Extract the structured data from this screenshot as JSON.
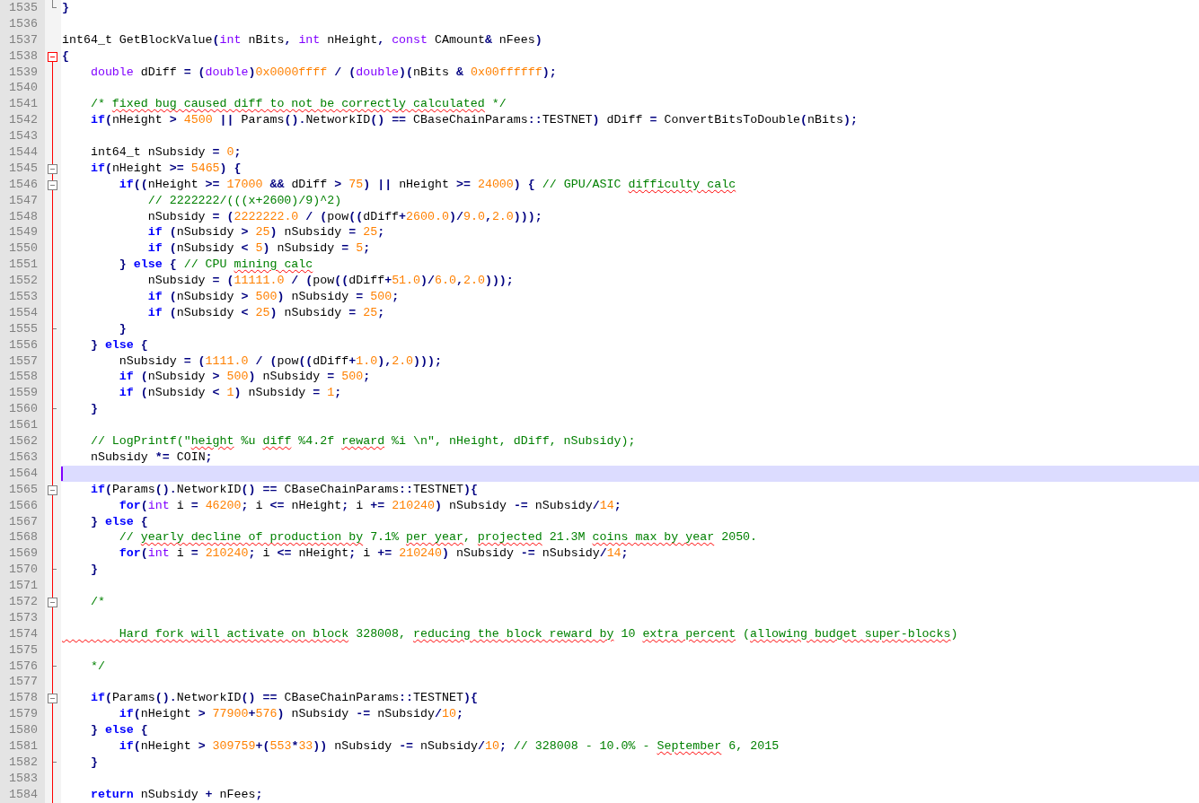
{
  "editor": {
    "lines": [
      {
        "number": "1535",
        "fold_open": false,
        "fold_end": true,
        "in_block": false,
        "current": false,
        "tokens": [
          {
            "kind": "op",
            "text": "}"
          }
        ]
      },
      {
        "number": "1536",
        "fold_open": false,
        "fold_end": false,
        "in_block": false,
        "current": false
      },
      {
        "number": "1537",
        "fold_open": false,
        "fold_end": false,
        "in_block": false,
        "current": false,
        "tokens": [
          {
            "kind": "plain",
            "text": "int64_t GetBlockValue"
          },
          {
            "kind": "op",
            "text": "("
          },
          {
            "kind": "type",
            "text": "int"
          },
          {
            "kind": "plain",
            "text": " nBits"
          },
          {
            "kind": "op",
            "text": ", "
          },
          {
            "kind": "type",
            "text": "int"
          },
          {
            "kind": "plain",
            "text": " nHeight"
          },
          {
            "kind": "op",
            "text": ", "
          },
          {
            "kind": "type",
            "text": "const"
          },
          {
            "kind": "plain",
            "text": " CAmount"
          },
          {
            "kind": "op",
            "text": "&"
          },
          {
            "kind": "plain",
            "text": " nFees"
          },
          {
            "kind": "op",
            "text": ")"
          }
        ]
      },
      {
        "number": "1538",
        "fold_open": true,
        "fold_end": false,
        "in_block": true,
        "current": false,
        "tokens": [
          {
            "kind": "op",
            "text": "{"
          }
        ]
      },
      {
        "number": "1539",
        "fold_open": false,
        "fold_end": false,
        "in_block": true,
        "current": false,
        "tokens": [
          {
            "kind": "type",
            "text": "    double"
          },
          {
            "kind": "plain",
            "text": " dDiff "
          },
          {
            "kind": "op",
            "text": "= ("
          },
          {
            "kind": "type",
            "text": "double"
          },
          {
            "kind": "op",
            "text": ")"
          },
          {
            "kind": "number",
            "text": "0x0000ffff"
          },
          {
            "kind": "op",
            "text": " / ("
          },
          {
            "kind": "type",
            "text": "double"
          },
          {
            "kind": "op",
            "text": ")("
          },
          {
            "kind": "plain",
            "text": "nBits "
          },
          {
            "kind": "op",
            "text": "& "
          },
          {
            "kind": "number",
            "text": "0x00ffffff"
          },
          {
            "kind": "op",
            "text": ");"
          }
        ]
      },
      {
        "number": "1540",
        "fold_open": false,
        "fold_end": false,
        "in_block": true,
        "current": false
      },
      {
        "number": "1541",
        "fold_open": false,
        "fold_end": false,
        "in_block": true,
        "current": false,
        "tokens": [
          {
            "kind": "comment",
            "text": "    /* "
          },
          {
            "kind": "typo",
            "text": "fixed bug caused diff to not be correctly calculated"
          },
          {
            "kind": "comment",
            "text": " */"
          }
        ]
      },
      {
        "number": "1542",
        "fold_open": false,
        "fold_end": false,
        "in_block": true,
        "current": false,
        "tokens": [
          {
            "kind": "keyword",
            "text": "    if"
          },
          {
            "kind": "op",
            "text": "("
          },
          {
            "kind": "plain",
            "text": "nHeight "
          },
          {
            "kind": "op",
            "text": "> "
          },
          {
            "kind": "number",
            "text": "4500"
          },
          {
            "kind": "op",
            "text": " || "
          },
          {
            "kind": "plain",
            "text": "Params"
          },
          {
            "kind": "op",
            "text": "()."
          },
          {
            "kind": "plain",
            "text": "NetworkID"
          },
          {
            "kind": "op",
            "text": "() == "
          },
          {
            "kind": "plain",
            "text": "CBaseChainParams"
          },
          {
            "kind": "op",
            "text": "::"
          },
          {
            "kind": "plain",
            "text": "TESTNET"
          },
          {
            "kind": "op",
            "text": ") "
          },
          {
            "kind": "plain",
            "text": "dDiff "
          },
          {
            "kind": "op",
            "text": "= "
          },
          {
            "kind": "plain",
            "text": "ConvertBitsToDouble"
          },
          {
            "kind": "op",
            "text": "("
          },
          {
            "kind": "plain",
            "text": "nBits"
          },
          {
            "kind": "op",
            "text": ");"
          }
        ]
      },
      {
        "number": "1543",
        "fold_open": false,
        "fold_end": false,
        "in_block": true,
        "current": false
      },
      {
        "number": "1544",
        "fold_open": false,
        "fold_end": false,
        "in_block": true,
        "current": false,
        "tokens": [
          {
            "kind": "plain",
            "text": "    int64_t nSubsidy "
          },
          {
            "kind": "op",
            "text": "= "
          },
          {
            "kind": "number",
            "text": "0"
          },
          {
            "kind": "op",
            "text": ";"
          }
        ]
      },
      {
        "number": "1545",
        "fold_open": true,
        "fold_end": false,
        "in_block": true,
        "current": false,
        "tokens": [
          {
            "kind": "keyword",
            "text": "    if"
          },
          {
            "kind": "op",
            "text": "("
          },
          {
            "kind": "plain",
            "text": "nHeight "
          },
          {
            "kind": "op",
            "text": ">= "
          },
          {
            "kind": "number",
            "text": "5465"
          },
          {
            "kind": "op",
            "text": ") {"
          }
        ]
      },
      {
        "number": "1546",
        "fold_open": true,
        "fold_end": false,
        "in_block": true,
        "current": false,
        "tokens": [
          {
            "kind": "keyword",
            "text": "        if"
          },
          {
            "kind": "op",
            "text": "(("
          },
          {
            "kind": "plain",
            "text": "nHeight "
          },
          {
            "kind": "op",
            "text": ">= "
          },
          {
            "kind": "number",
            "text": "17000"
          },
          {
            "kind": "op",
            "text": " && "
          },
          {
            "kind": "plain",
            "text": "dDiff "
          },
          {
            "kind": "op",
            "text": "> "
          },
          {
            "kind": "number",
            "text": "75"
          },
          {
            "kind": "op",
            "text": ") || "
          },
          {
            "kind": "plain",
            "text": "nHeight "
          },
          {
            "kind": "op",
            "text": ">= "
          },
          {
            "kind": "number",
            "text": "24000"
          },
          {
            "kind": "op",
            "text": ") { "
          },
          {
            "kind": "comment",
            "text": "// GPU/ASIC "
          },
          {
            "kind": "typo",
            "text": "difficulty calc"
          }
        ]
      },
      {
        "number": "1547",
        "fold_open": false,
        "fold_end": false,
        "in_block": true,
        "current": false,
        "tokens": [
          {
            "kind": "comment",
            "text": "            // 2222222/(((x+2600)/9)^2)"
          }
        ]
      },
      {
        "number": "1548",
        "fold_open": false,
        "fold_end": false,
        "in_block": true,
        "current": false,
        "tokens": [
          {
            "kind": "plain",
            "text": "            nSubsidy "
          },
          {
            "kind": "op",
            "text": "= ("
          },
          {
            "kind": "number",
            "text": "2222222.0"
          },
          {
            "kind": "op",
            "text": " / ("
          },
          {
            "kind": "plain",
            "text": "pow"
          },
          {
            "kind": "op",
            "text": "(("
          },
          {
            "kind": "plain",
            "text": "dDiff"
          },
          {
            "kind": "op",
            "text": "+"
          },
          {
            "kind": "number",
            "text": "2600.0"
          },
          {
            "kind": "op",
            "text": ")/"
          },
          {
            "kind": "number",
            "text": "9.0"
          },
          {
            "kind": "op",
            "text": ","
          },
          {
            "kind": "number",
            "text": "2.0"
          },
          {
            "kind": "op",
            "text": ")));"
          }
        ]
      },
      {
        "number": "1549",
        "fold_open": false,
        "fold_end": false,
        "in_block": true,
        "current": false,
        "tokens": [
          {
            "kind": "keyword",
            "text": "            if"
          },
          {
            "kind": "op",
            "text": " ("
          },
          {
            "kind": "plain",
            "text": "nSubsidy "
          },
          {
            "kind": "op",
            "text": "> "
          },
          {
            "kind": "number",
            "text": "25"
          },
          {
            "kind": "op",
            "text": ") "
          },
          {
            "kind": "plain",
            "text": "nSubsidy "
          },
          {
            "kind": "op",
            "text": "= "
          },
          {
            "kind": "number",
            "text": "25"
          },
          {
            "kind": "op",
            "text": ";"
          }
        ]
      },
      {
        "number": "1550",
        "fold_open": false,
        "fold_end": false,
        "in_block": true,
        "current": false,
        "tokens": [
          {
            "kind": "keyword",
            "text": "            if"
          },
          {
            "kind": "op",
            "text": " ("
          },
          {
            "kind": "plain",
            "text": "nSubsidy "
          },
          {
            "kind": "op",
            "text": "< "
          },
          {
            "kind": "number",
            "text": "5"
          },
          {
            "kind": "op",
            "text": ") "
          },
          {
            "kind": "plain",
            "text": "nSubsidy "
          },
          {
            "kind": "op",
            "text": "= "
          },
          {
            "kind": "number",
            "text": "5"
          },
          {
            "kind": "op",
            "text": ";"
          }
        ]
      },
      {
        "number": "1551",
        "fold_open": false,
        "fold_end": false,
        "in_block": true,
        "current": false,
        "tokens": [
          {
            "kind": "op",
            "text": "        } "
          },
          {
            "kind": "keyword",
            "text": "else"
          },
          {
            "kind": "op",
            "text": " { "
          },
          {
            "kind": "comment",
            "text": "// CPU "
          },
          {
            "kind": "typo",
            "text": "mining calc"
          }
        ]
      },
      {
        "number": "1552",
        "fold_open": false,
        "fold_end": false,
        "in_block": true,
        "current": false,
        "tokens": [
          {
            "kind": "plain",
            "text": "            nSubsidy "
          },
          {
            "kind": "op",
            "text": "= ("
          },
          {
            "kind": "number",
            "text": "11111.0"
          },
          {
            "kind": "op",
            "text": " / ("
          },
          {
            "kind": "plain",
            "text": "pow"
          },
          {
            "kind": "op",
            "text": "(("
          },
          {
            "kind": "plain",
            "text": "dDiff"
          },
          {
            "kind": "op",
            "text": "+"
          },
          {
            "kind": "number",
            "text": "51.0"
          },
          {
            "kind": "op",
            "text": ")/"
          },
          {
            "kind": "number",
            "text": "6.0"
          },
          {
            "kind": "op",
            "text": ","
          },
          {
            "kind": "number",
            "text": "2.0"
          },
          {
            "kind": "op",
            "text": ")));"
          }
        ]
      },
      {
        "number": "1553",
        "fold_open": false,
        "fold_end": false,
        "in_block": true,
        "current": false,
        "tokens": [
          {
            "kind": "keyword",
            "text": "            if"
          },
          {
            "kind": "op",
            "text": " ("
          },
          {
            "kind": "plain",
            "text": "nSubsidy "
          },
          {
            "kind": "op",
            "text": "> "
          },
          {
            "kind": "number",
            "text": "500"
          },
          {
            "kind": "op",
            "text": ") "
          },
          {
            "kind": "plain",
            "text": "nSubsidy "
          },
          {
            "kind": "op",
            "text": "= "
          },
          {
            "kind": "number",
            "text": "500"
          },
          {
            "kind": "op",
            "text": ";"
          }
        ]
      },
      {
        "number": "1554",
        "fold_open": false,
        "fold_end": false,
        "in_block": true,
        "current": false,
        "tokens": [
          {
            "kind": "keyword",
            "text": "            if"
          },
          {
            "kind": "op",
            "text": " ("
          },
          {
            "kind": "plain",
            "text": "nSubsidy "
          },
          {
            "kind": "op",
            "text": "< "
          },
          {
            "kind": "number",
            "text": "25"
          },
          {
            "kind": "op",
            "text": ") "
          },
          {
            "kind": "plain",
            "text": "nSubsidy "
          },
          {
            "kind": "op",
            "text": "= "
          },
          {
            "kind": "number",
            "text": "25"
          },
          {
            "kind": "op",
            "text": ";"
          }
        ]
      },
      {
        "number": "1555",
        "fold_open": false,
        "fold_end": true,
        "in_block": true,
        "current": false,
        "tokens": [
          {
            "kind": "op",
            "text": "        }"
          }
        ]
      },
      {
        "number": "1556",
        "fold_open": false,
        "fold_end": false,
        "in_block": true,
        "current": false,
        "tokens": [
          {
            "kind": "op",
            "text": "    } "
          },
          {
            "kind": "keyword",
            "text": "else"
          },
          {
            "kind": "op",
            "text": " {"
          }
        ]
      },
      {
        "number": "1557",
        "fold_open": false,
        "fold_end": false,
        "in_block": true,
        "current": false,
        "tokens": [
          {
            "kind": "plain",
            "text": "        nSubsidy "
          },
          {
            "kind": "op",
            "text": "= ("
          },
          {
            "kind": "number",
            "text": "1111.0"
          },
          {
            "kind": "op",
            "text": " / ("
          },
          {
            "kind": "plain",
            "text": "pow"
          },
          {
            "kind": "op",
            "text": "(("
          },
          {
            "kind": "plain",
            "text": "dDiff"
          },
          {
            "kind": "op",
            "text": "+"
          },
          {
            "kind": "number",
            "text": "1.0"
          },
          {
            "kind": "op",
            "text": "),"
          },
          {
            "kind": "number",
            "text": "2.0"
          },
          {
            "kind": "op",
            "text": ")));"
          }
        ]
      },
      {
        "number": "1558",
        "fold_open": false,
        "fold_end": false,
        "in_block": true,
        "current": false,
        "tokens": [
          {
            "kind": "keyword",
            "text": "        if"
          },
          {
            "kind": "op",
            "text": " ("
          },
          {
            "kind": "plain",
            "text": "nSubsidy "
          },
          {
            "kind": "op",
            "text": "> "
          },
          {
            "kind": "number",
            "text": "500"
          },
          {
            "kind": "op",
            "text": ") "
          },
          {
            "kind": "plain",
            "text": "nSubsidy "
          },
          {
            "kind": "op",
            "text": "= "
          },
          {
            "kind": "number",
            "text": "500"
          },
          {
            "kind": "op",
            "text": ";"
          }
        ]
      },
      {
        "number": "1559",
        "fold_open": false,
        "fold_end": false,
        "in_block": true,
        "current": false,
        "tokens": [
          {
            "kind": "keyword",
            "text": "        if"
          },
          {
            "kind": "op",
            "text": " ("
          },
          {
            "kind": "plain",
            "text": "nSubsidy "
          },
          {
            "kind": "op",
            "text": "< "
          },
          {
            "kind": "number",
            "text": "1"
          },
          {
            "kind": "op",
            "text": ") "
          },
          {
            "kind": "plain",
            "text": "nSubsidy "
          },
          {
            "kind": "op",
            "text": "= "
          },
          {
            "kind": "number",
            "text": "1"
          },
          {
            "kind": "op",
            "text": ";"
          }
        ]
      },
      {
        "number": "1560",
        "fold_open": false,
        "fold_end": true,
        "in_block": true,
        "current": false,
        "tokens": [
          {
            "kind": "op",
            "text": "    }"
          }
        ]
      },
      {
        "number": "1561",
        "fold_open": false,
        "fold_end": false,
        "in_block": true,
        "current": false
      },
      {
        "number": "1562",
        "fold_open": false,
        "fold_end": false,
        "in_block": true,
        "current": false,
        "tokens": [
          {
            "kind": "comment",
            "text": "    // LogPrintf(\""
          },
          {
            "kind": "typo",
            "text": "height"
          },
          {
            "kind": "comment",
            "text": " %u "
          },
          {
            "kind": "typo",
            "text": "diff"
          },
          {
            "kind": "comment",
            "text": " %4.2f "
          },
          {
            "kind": "typo",
            "text": "reward"
          },
          {
            "kind": "comment",
            "text": " %i \\n\", nHeight, dDiff, nSubsidy);"
          }
        ]
      },
      {
        "number": "1563",
        "fold_open": false,
        "fold_end": false,
        "in_block": true,
        "current": false,
        "tokens": [
          {
            "kind": "plain",
            "text": "    nSubsidy "
          },
          {
            "kind": "op",
            "text": "*= "
          },
          {
            "kind": "plain",
            "text": "COIN"
          },
          {
            "kind": "op",
            "text": ";"
          }
        ]
      },
      {
        "number": "1564",
        "fold_open": false,
        "fold_end": false,
        "in_block": true,
        "current": true
      },
      {
        "number": "1565",
        "fold_open": true,
        "fold_end": false,
        "in_block": true,
        "current": false,
        "tokens": [
          {
            "kind": "keyword",
            "text": "    if"
          },
          {
            "kind": "op",
            "text": "("
          },
          {
            "kind": "plain",
            "text": "Params"
          },
          {
            "kind": "op",
            "text": "()."
          },
          {
            "kind": "plain",
            "text": "NetworkID"
          },
          {
            "kind": "op",
            "text": "() == "
          },
          {
            "kind": "plain",
            "text": "CBaseChainParams"
          },
          {
            "kind": "op",
            "text": "::"
          },
          {
            "kind": "plain",
            "text": "TESTNET"
          },
          {
            "kind": "op",
            "text": "){"
          }
        ]
      },
      {
        "number": "1566",
        "fold_open": false,
        "fold_end": false,
        "in_block": true,
        "current": false,
        "tokens": [
          {
            "kind": "keyword",
            "text": "        for"
          },
          {
            "kind": "op",
            "text": "("
          },
          {
            "kind": "type",
            "text": "int"
          },
          {
            "kind": "plain",
            "text": " i "
          },
          {
            "kind": "op",
            "text": "= "
          },
          {
            "kind": "number",
            "text": "46200"
          },
          {
            "kind": "op",
            "text": "; "
          },
          {
            "kind": "plain",
            "text": "i "
          },
          {
            "kind": "op",
            "text": "<= "
          },
          {
            "kind": "plain",
            "text": "nHeight"
          },
          {
            "kind": "op",
            "text": "; "
          },
          {
            "kind": "plain",
            "text": "i "
          },
          {
            "kind": "op",
            "text": "+= "
          },
          {
            "kind": "number",
            "text": "210240"
          },
          {
            "kind": "op",
            "text": ") "
          },
          {
            "kind": "plain",
            "text": "nSubsidy "
          },
          {
            "kind": "op",
            "text": "-= "
          },
          {
            "kind": "plain",
            "text": "nSubsidy"
          },
          {
            "kind": "op",
            "text": "/"
          },
          {
            "kind": "number",
            "text": "14"
          },
          {
            "kind": "op",
            "text": ";"
          }
        ]
      },
      {
        "number": "1567",
        "fold_open": false,
        "fold_end": false,
        "in_block": true,
        "current": false,
        "tokens": [
          {
            "kind": "op",
            "text": "    } "
          },
          {
            "kind": "keyword",
            "text": "else"
          },
          {
            "kind": "op",
            "text": " {"
          }
        ]
      },
      {
        "number": "1568",
        "fold_open": false,
        "fold_end": false,
        "in_block": true,
        "current": false,
        "tokens": [
          {
            "kind": "comment",
            "text": "        // "
          },
          {
            "kind": "typo",
            "text": "yearly decline of production by"
          },
          {
            "kind": "comment",
            "text": " 7.1% "
          },
          {
            "kind": "typo",
            "text": "per year"
          },
          {
            "kind": "comment",
            "text": ", "
          },
          {
            "kind": "typo",
            "text": "projected"
          },
          {
            "kind": "comment",
            "text": " 21.3M "
          },
          {
            "kind": "typo",
            "text": "coins max by year"
          },
          {
            "kind": "comment",
            "text": " 2050."
          }
        ]
      },
      {
        "number": "1569",
        "fold_open": false,
        "fold_end": false,
        "in_block": true,
        "current": false,
        "tokens": [
          {
            "kind": "keyword",
            "text": "        for"
          },
          {
            "kind": "op",
            "text": "("
          },
          {
            "kind": "type",
            "text": "int"
          },
          {
            "kind": "plain",
            "text": " i "
          },
          {
            "kind": "op",
            "text": "= "
          },
          {
            "kind": "number",
            "text": "210240"
          },
          {
            "kind": "op",
            "text": "; "
          },
          {
            "kind": "plain",
            "text": "i "
          },
          {
            "kind": "op",
            "text": "<= "
          },
          {
            "kind": "plain",
            "text": "nHeight"
          },
          {
            "kind": "op",
            "text": "; "
          },
          {
            "kind": "plain",
            "text": "i "
          },
          {
            "kind": "op",
            "text": "+= "
          },
          {
            "kind": "number",
            "text": "210240"
          },
          {
            "kind": "op",
            "text": ") "
          },
          {
            "kind": "plain",
            "text": "nSubsidy "
          },
          {
            "kind": "op",
            "text": "-= "
          },
          {
            "kind": "plain",
            "text": "nSubsidy"
          },
          {
            "kind": "op",
            "text": "/"
          },
          {
            "kind": "number",
            "text": "14"
          },
          {
            "kind": "op",
            "text": ";"
          }
        ]
      },
      {
        "number": "1570",
        "fold_open": false,
        "fold_end": true,
        "in_block": true,
        "current": false,
        "tokens": [
          {
            "kind": "op",
            "text": "    }"
          }
        ]
      },
      {
        "number": "1571",
        "fold_open": false,
        "fold_end": false,
        "in_block": true,
        "current": false
      },
      {
        "number": "1572",
        "fold_open": true,
        "fold_end": false,
        "in_block": true,
        "current": false,
        "tokens": [
          {
            "kind": "comment",
            "text": "    /*"
          }
        ]
      },
      {
        "number": "1573",
        "fold_open": false,
        "fold_end": false,
        "in_block": true,
        "current": false
      },
      {
        "number": "1574",
        "fold_open": false,
        "fold_end": false,
        "in_block": true,
        "current": false,
        "tokens": [
          {
            "kind": "typo",
            "text": "        Hard fork will activate on block"
          },
          {
            "kind": "comment",
            "text": " 328008, "
          },
          {
            "kind": "typo",
            "text": "reducing the block reward by"
          },
          {
            "kind": "comment",
            "text": " 10 "
          },
          {
            "kind": "typo",
            "text": "extra percent"
          },
          {
            "kind": "comment",
            "text": " ("
          },
          {
            "kind": "typo",
            "text": "allowing budget super-blocks"
          },
          {
            "kind": "comment",
            "text": ")"
          }
        ]
      },
      {
        "number": "1575",
        "fold_open": false,
        "fold_end": false,
        "in_block": true,
        "current": false
      },
      {
        "number": "1576",
        "fold_open": false,
        "fold_end": true,
        "in_block": true,
        "current": false,
        "tokens": [
          {
            "kind": "comment",
            "text": "    */"
          }
        ]
      },
      {
        "number": "1577",
        "fold_open": false,
        "fold_end": false,
        "in_block": true,
        "current": false
      },
      {
        "number": "1578",
        "fold_open": true,
        "fold_end": false,
        "in_block": true,
        "current": false,
        "tokens": [
          {
            "kind": "keyword",
            "text": "    if"
          },
          {
            "kind": "op",
            "text": "("
          },
          {
            "kind": "plain",
            "text": "Params"
          },
          {
            "kind": "op",
            "text": "()."
          },
          {
            "kind": "plain",
            "text": "NetworkID"
          },
          {
            "kind": "op",
            "text": "() == "
          },
          {
            "kind": "plain",
            "text": "CBaseChainParams"
          },
          {
            "kind": "op",
            "text": "::"
          },
          {
            "kind": "plain",
            "text": "TESTNET"
          },
          {
            "kind": "op",
            "text": "){"
          }
        ]
      },
      {
        "number": "1579",
        "fold_open": false,
        "fold_end": false,
        "in_block": true,
        "current": false,
        "tokens": [
          {
            "kind": "keyword",
            "text": "        if"
          },
          {
            "kind": "op",
            "text": "("
          },
          {
            "kind": "plain",
            "text": "nHeight "
          },
          {
            "kind": "op",
            "text": "> "
          },
          {
            "kind": "number",
            "text": "77900"
          },
          {
            "kind": "op",
            "text": "+"
          },
          {
            "kind": "number",
            "text": "576"
          },
          {
            "kind": "op",
            "text": ") "
          },
          {
            "kind": "plain",
            "text": "nSubsidy "
          },
          {
            "kind": "op",
            "text": "-= "
          },
          {
            "kind": "plain",
            "text": "nSubsidy"
          },
          {
            "kind": "op",
            "text": "/"
          },
          {
            "kind": "number",
            "text": "10"
          },
          {
            "kind": "op",
            "text": ";"
          }
        ]
      },
      {
        "number": "1580",
        "fold_open": false,
        "fold_end": false,
        "in_block": true,
        "current": false,
        "tokens": [
          {
            "kind": "op",
            "text": "    } "
          },
          {
            "kind": "keyword",
            "text": "else"
          },
          {
            "kind": "op",
            "text": " {"
          }
        ]
      },
      {
        "number": "1581",
        "fold_open": false,
        "fold_end": false,
        "in_block": true,
        "current": false,
        "tokens": [
          {
            "kind": "keyword",
            "text": "        if"
          },
          {
            "kind": "op",
            "text": "("
          },
          {
            "kind": "plain",
            "text": "nHeight "
          },
          {
            "kind": "op",
            "text": "> "
          },
          {
            "kind": "number",
            "text": "309759"
          },
          {
            "kind": "op",
            "text": "+("
          },
          {
            "kind": "number",
            "text": "553"
          },
          {
            "kind": "op",
            "text": "*"
          },
          {
            "kind": "number",
            "text": "33"
          },
          {
            "kind": "op",
            "text": ")) "
          },
          {
            "kind": "plain",
            "text": "nSubsidy "
          },
          {
            "kind": "op",
            "text": "-= "
          },
          {
            "kind": "plain",
            "text": "nSubsidy"
          },
          {
            "kind": "op",
            "text": "/"
          },
          {
            "kind": "number",
            "text": "10"
          },
          {
            "kind": "op",
            "text": "; "
          },
          {
            "kind": "comment",
            "text": "// 328008 - 10.0% - "
          },
          {
            "kind": "typo",
            "text": "September"
          },
          {
            "kind": "comment",
            "text": " 6, 2015"
          }
        ]
      },
      {
        "number": "1582",
        "fold_open": false,
        "fold_end": true,
        "in_block": true,
        "current": false,
        "tokens": [
          {
            "kind": "op",
            "text": "    }"
          }
        ]
      },
      {
        "number": "1583",
        "fold_open": false,
        "fold_end": false,
        "in_block": true,
        "current": false
      },
      {
        "number": "1584",
        "fold_open": false,
        "fold_end": false,
        "in_block": true,
        "current": false,
        "tokens": [
          {
            "kind": "keyword",
            "text": "    return"
          },
          {
            "kind": "plain",
            "text": " nSubsidy "
          },
          {
            "kind": "op",
            "text": "+ "
          },
          {
            "kind": "plain",
            "text": "nFees"
          },
          {
            "kind": "op",
            "text": ";"
          }
        ]
      }
    ]
  }
}
